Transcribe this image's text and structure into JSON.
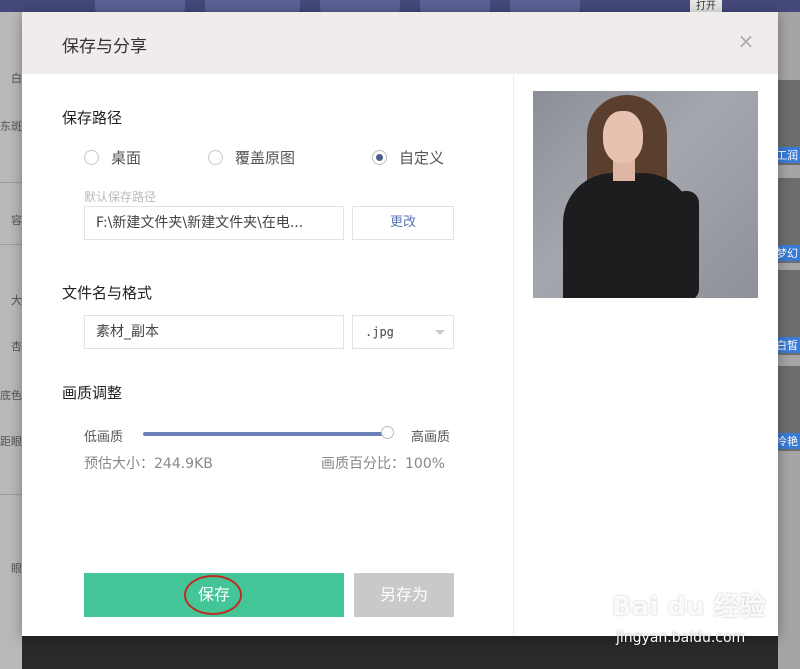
{
  "background": {
    "left_items": [
      {
        "label": "白"
      },
      {
        "label": "东斑"
      },
      {
        "label": "容"
      },
      {
        "label": "大"
      },
      {
        "label": "杏"
      },
      {
        "label": "底色"
      },
      {
        "label": "距眼圆"
      },
      {
        "label": "眼"
      }
    ],
    "right_thumbs": [
      {
        "label": "工润"
      },
      {
        "label": "梦幻"
      },
      {
        "label": "白皙"
      },
      {
        "label": "冷艳"
      }
    ],
    "top_right_btn": "打开"
  },
  "dialog": {
    "title": "保存与分享",
    "close_glyph": "×",
    "save_path": {
      "title": "保存路径",
      "options": [
        {
          "label": "桌面",
          "checked": false
        },
        {
          "label": "覆盖原图",
          "checked": false
        },
        {
          "label": "自定义",
          "checked": true
        }
      ],
      "hint": "默认保存路径",
      "path_value": "F:\\新建文件夹\\新建文件夹\\在电...",
      "change_button": "更改"
    },
    "file_name": {
      "title": "文件名与格式",
      "name_value": "素材_副本",
      "format_value": ".jpg"
    },
    "quality": {
      "title": "画质调整",
      "low_label": "低画质",
      "high_label": "高画质",
      "level_percent": 100,
      "estimated_size": "预估大小：244.9KB",
      "percent_text": "画质百分比：100%"
    },
    "buttons": {
      "save": "保存",
      "save_as": "另存为"
    }
  },
  "watermark": {
    "logo_text": "Bai du 经验",
    "url": "jingyan.baidu.com"
  }
}
